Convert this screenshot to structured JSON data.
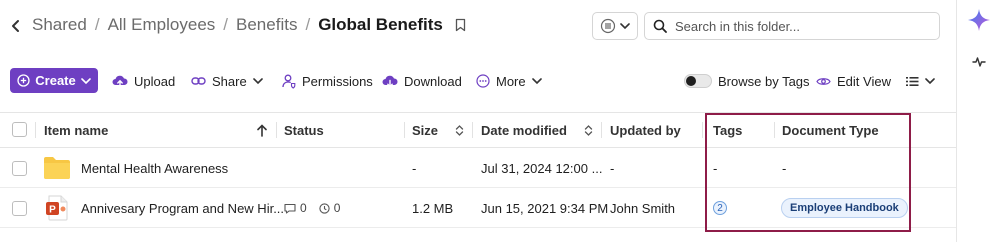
{
  "breadcrumb": {
    "items": [
      "Shared",
      "All Employees",
      "Benefits"
    ],
    "current": "Global Benefits",
    "separator": "/"
  },
  "search": {
    "placeholder": "Search in this folder..."
  },
  "toolbar": {
    "create": "Create",
    "upload": "Upload",
    "share": "Share",
    "permissions": "Permissions",
    "download": "Download",
    "more": "More",
    "browse_by_tags": "Browse by Tags",
    "edit_view": "Edit View"
  },
  "columns": {
    "item_name": "Item name",
    "status": "Status",
    "size": "Size",
    "date_modified": "Date modified",
    "updated_by": "Updated by",
    "tags": "Tags",
    "document_type": "Document Type"
  },
  "rows": [
    {
      "type": "folder",
      "name": "Mental Health Awareness",
      "status_comments": "",
      "status_tasks": "",
      "size": "-",
      "date_modified": "Jul 31, 2024 12:00 ...",
      "updated_by": "-",
      "tags": "-",
      "document_type": "-"
    },
    {
      "type": "powerpoint",
      "name": "Annivesary Program and New Hir...",
      "status_comments": "0",
      "status_tasks": "0",
      "size": "1.2 MB",
      "date_modified": "Jun 15, 2021 9:34 PM",
      "updated_by": "John Smith",
      "tags": "2",
      "document_type": "Employee Handbook"
    }
  ],
  "colors": {
    "accent": "#6e3fc2",
    "highlight_border": "#8e1c48",
    "folder": "#f7c744",
    "powerpoint": "#d04423",
    "tag_badge_bg": "#eaf2fd"
  }
}
